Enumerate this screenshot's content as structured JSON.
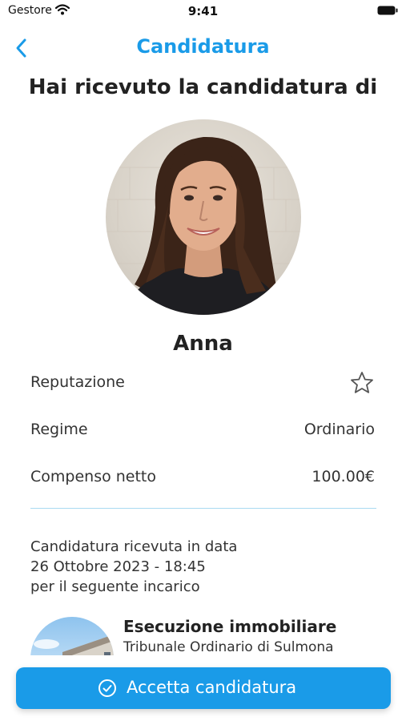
{
  "status_bar": {
    "carrier": "Gestore",
    "time": "9:41"
  },
  "nav": {
    "title": "Candidatura",
    "back_icon": "chevron-left-icon"
  },
  "heading": "Hai ricevuto la candidatura di",
  "candidate": {
    "name": "Anna",
    "details": [
      {
        "label": "Reputazione",
        "value": "",
        "icon": "star-outline-icon"
      },
      {
        "label": "Regime",
        "value": "Ordinario"
      },
      {
        "label": "Compenso netto",
        "value": "100.00€"
      }
    ]
  },
  "received": {
    "line1": "Candidatura ricevuta in data",
    "line2": "26 Ottobre 2023 - 18:45",
    "line3": "per il seguente incarico"
  },
  "assignment": {
    "title": "Esecuzione immobiliare",
    "subtitle": "Tribunale Ordinario di Sulmona"
  },
  "actions": {
    "accept_label": "Accetta candidatura",
    "accept_icon": "check-circle-icon"
  },
  "colors": {
    "accent": "#1a9be8",
    "divider": "#a9daf2",
    "text": "#222222"
  }
}
